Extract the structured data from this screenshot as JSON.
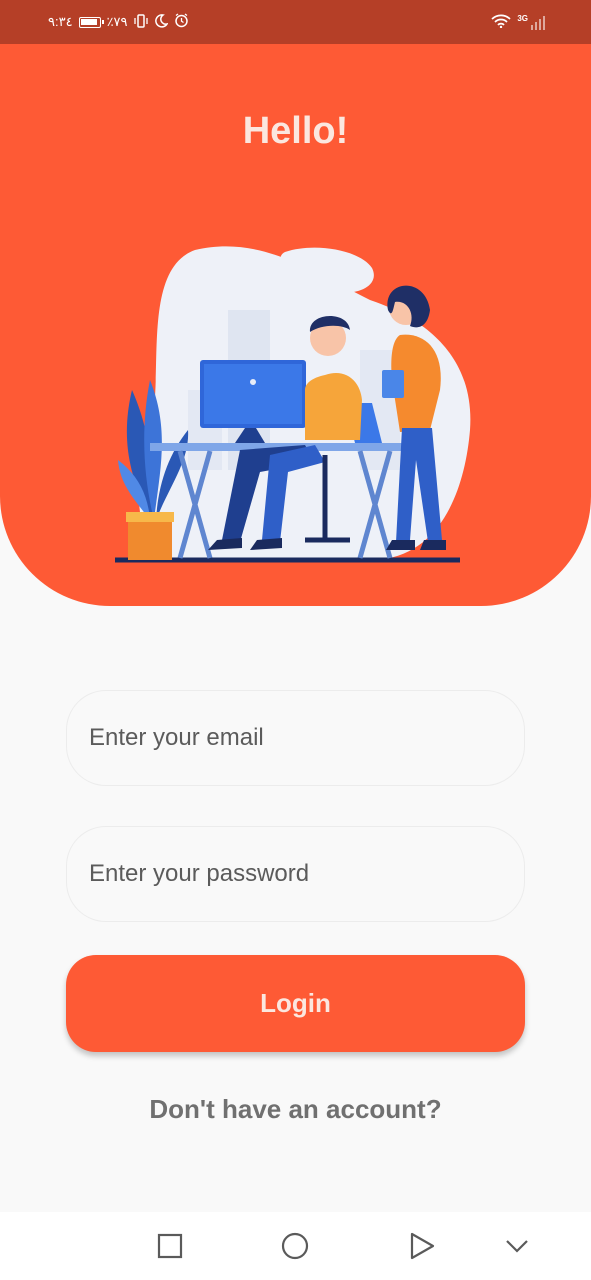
{
  "status_bar": {
    "time": "٩:٣٤",
    "battery": "٪٧٩",
    "network": "3G",
    "icons": [
      "battery-icon",
      "vibrate-icon",
      "moon-icon",
      "alarm-icon",
      "wifi-icon",
      "signal-icon"
    ]
  },
  "hero": {
    "title": "Hello!",
    "background_color": "#fe5a35"
  },
  "form": {
    "email_placeholder": "Enter your email",
    "email_value": "",
    "password_placeholder": "Enter your password",
    "password_value": "",
    "login_label": "Login",
    "signup_prompt": "Don't have an account?"
  },
  "nav_bar": {
    "icons": [
      "recent-apps-icon",
      "home-icon",
      "back-icon",
      "collapse-icon"
    ]
  }
}
